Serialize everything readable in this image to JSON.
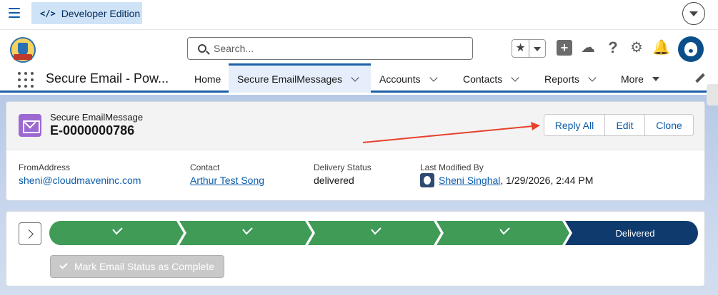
{
  "devbar": {
    "label": "Developer Edition",
    "code_icon": "code-icon"
  },
  "header": {
    "search_placeholder": "Search...",
    "icons": [
      "star-icon",
      "plus-icon",
      "trailhead-icon",
      "help-icon",
      "gear-icon",
      "bell-icon",
      "avatar-icon"
    ]
  },
  "nav": {
    "app_name": "Secure Email - Pow...",
    "tabs": [
      {
        "label": "Home"
      },
      {
        "label": "Secure EmailMessages"
      },
      {
        "label": "Accounts"
      },
      {
        "label": "Contacts"
      },
      {
        "label": "Reports"
      },
      {
        "label": "More"
      }
    ]
  },
  "record": {
    "type": "Secure EmailMessage",
    "name": "E-0000000786",
    "actions": [
      "Reply All",
      "Edit",
      "Clone"
    ],
    "fields": [
      {
        "label": "FromAddress",
        "value": "sheni@cloudmaveninc.com"
      },
      {
        "label": "Contact",
        "value": "Arthur Test Song"
      },
      {
        "label": "Delivery Status",
        "value": "delivered"
      },
      {
        "label": "Last Modified By",
        "value": "Sheni Singhal",
        "suffix": ", 1/29/2026, 2:44 PM"
      }
    ]
  },
  "path": {
    "stages": [
      "",
      "",
      "",
      "",
      "Delivered"
    ],
    "mark_complete": "Mark Email Status as Complete"
  },
  "colors": {
    "accent": "#0b5cab",
    "path_complete": "#3f9b55",
    "path_current": "#0e3a6e",
    "annotation": "#e8412c"
  }
}
